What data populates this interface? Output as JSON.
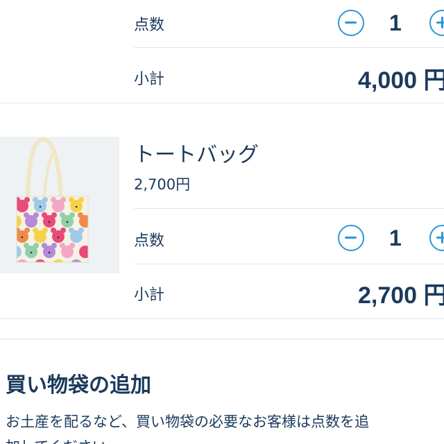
{
  "cart_items": [
    {
      "quantity_label": "点数",
      "quantity": "1",
      "subtotal_label": "小計",
      "subtotal": "4,000 円"
    },
    {
      "name": "トートバッグ",
      "unit_price": "2,700円",
      "image_icon": "tote-bag-image",
      "quantity_label": "点数",
      "quantity": "1",
      "subtotal_label": "小計",
      "subtotal": "2,700 円"
    }
  ],
  "shopping_bag_section": {
    "title": "買い物袋の追加",
    "description_line1": "お土産を配るなど、買い物袋の必要なお客様は点数を追",
    "description_line2": "加してください。"
  },
  "colors": {
    "text": "#1b3a5c",
    "accent": "#2e96d3",
    "divider": "#e2e7ec"
  }
}
